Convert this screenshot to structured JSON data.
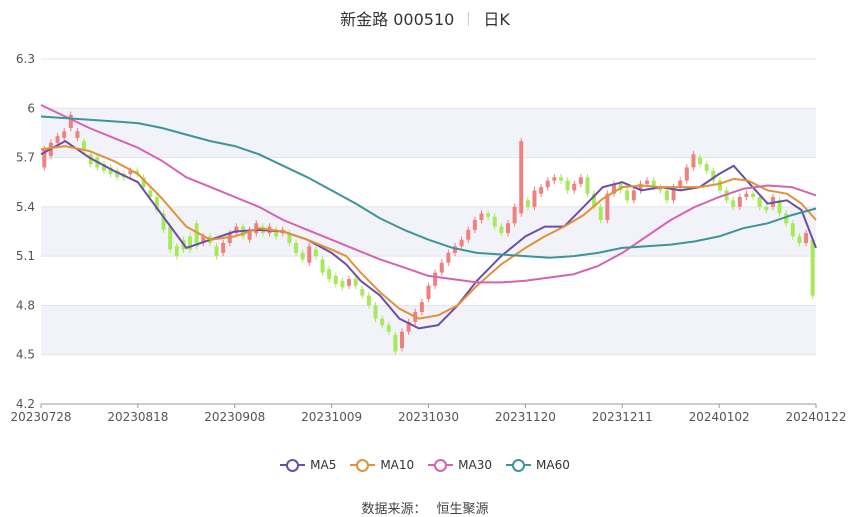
{
  "title": {
    "name": "新金路 000510",
    "period": "日K"
  },
  "legend": [
    {
      "label": "MA5",
      "color": "#6b4ea8"
    },
    {
      "label": "MA10",
      "color": "#e2913a"
    },
    {
      "label": "MA30",
      "color": "#d763b0"
    },
    {
      "label": "MA60",
      "color": "#3d9499"
    }
  ],
  "source": {
    "label": "数据来源：",
    "value": "恒生聚源"
  },
  "colors": {
    "up": "#f07f7f",
    "down": "#a6ea58",
    "band": "#f2f3f8",
    "grid": "#e2e4ea"
  },
  "chart_data": {
    "type": "candlestick",
    "title": "新金路 000510 日K",
    "x_tick_labels": [
      "20230728",
      "20230818",
      "20230908",
      "20231009",
      "20231030",
      "20231120",
      "20231211",
      "20240102",
      "20240122"
    ],
    "y_tick_labels": [
      "6.3",
      "6",
      "5.7",
      "5.4",
      "5.1",
      "4.8",
      "4.5",
      "4.2"
    ],
    "ylim": [
      4.2,
      6.3
    ],
    "y_ticks": [
      6.3,
      6.0,
      5.7,
      5.4,
      5.1,
      4.8,
      4.5,
      4.2
    ],
    "date_range": [
      "20230728",
      "20240122"
    ],
    "series": [
      {
        "name": "MA5",
        "points": [
          [
            0,
            5.72
          ],
          [
            5,
            5.8
          ],
          [
            10,
            5.7
          ],
          [
            15,
            5.62
          ],
          [
            20,
            5.55
          ],
          [
            25,
            5.35
          ],
          [
            30,
            5.15
          ],
          [
            35,
            5.2
          ],
          [
            40,
            5.25
          ],
          [
            45,
            5.26
          ],
          [
            50,
            5.25
          ],
          [
            55,
            5.2
          ],
          [
            60,
            5.12
          ],
          [
            63,
            5.05
          ],
          [
            66,
            4.95
          ],
          [
            70,
            4.86
          ],
          [
            74,
            4.72
          ],
          [
            78,
            4.66
          ],
          [
            82,
            4.68
          ],
          [
            86,
            4.8
          ],
          [
            90,
            4.95
          ],
          [
            95,
            5.1
          ],
          [
            100,
            5.22
          ],
          [
            104,
            5.28
          ],
          [
            108,
            5.28
          ],
          [
            112,
            5.4
          ],
          [
            116,
            5.52
          ],
          [
            120,
            5.55
          ],
          [
            124,
            5.5
          ],
          [
            128,
            5.52
          ],
          [
            132,
            5.5
          ],
          [
            136,
            5.52
          ],
          [
            140,
            5.6
          ],
          [
            143,
            5.65
          ],
          [
            146,
            5.55
          ],
          [
            150,
            5.42
          ],
          [
            154,
            5.44
          ],
          [
            157,
            5.38
          ],
          [
            160,
            5.15
          ]
        ]
      },
      {
        "name": "MA10",
        "points": [
          [
            0,
            5.75
          ],
          [
            5,
            5.77
          ],
          [
            10,
            5.74
          ],
          [
            15,
            5.68
          ],
          [
            20,
            5.6
          ],
          [
            25,
            5.45
          ],
          [
            30,
            5.28
          ],
          [
            35,
            5.2
          ],
          [
            40,
            5.22
          ],
          [
            45,
            5.27
          ],
          [
            50,
            5.25
          ],
          [
            55,
            5.2
          ],
          [
            60,
            5.14
          ],
          [
            63,
            5.1
          ],
          [
            66,
            5.0
          ],
          [
            70,
            4.88
          ],
          [
            74,
            4.78
          ],
          [
            78,
            4.72
          ],
          [
            82,
            4.74
          ],
          [
            86,
            4.8
          ],
          [
            90,
            4.92
          ],
          [
            95,
            5.05
          ],
          [
            100,
            5.15
          ],
          [
            104,
            5.22
          ],
          [
            108,
            5.28
          ],
          [
            112,
            5.35
          ],
          [
            116,
            5.45
          ],
          [
            120,
            5.52
          ],
          [
            124,
            5.53
          ],
          [
            128,
            5.52
          ],
          [
            132,
            5.52
          ],
          [
            136,
            5.52
          ],
          [
            140,
            5.54
          ],
          [
            143,
            5.57
          ],
          [
            146,
            5.56
          ],
          [
            150,
            5.5
          ],
          [
            154,
            5.48
          ],
          [
            157,
            5.42
          ],
          [
            160,
            5.32
          ]
        ]
      },
      {
        "name": "MA30",
        "points": [
          [
            0,
            6.02
          ],
          [
            5,
            5.95
          ],
          [
            10,
            5.88
          ],
          [
            15,
            5.82
          ],
          [
            20,
            5.76
          ],
          [
            25,
            5.68
          ],
          [
            30,
            5.58
          ],
          [
            35,
            5.52
          ],
          [
            40,
            5.46
          ],
          [
            45,
            5.4
          ],
          [
            50,
            5.32
          ],
          [
            55,
            5.26
          ],
          [
            60,
            5.2
          ],
          [
            65,
            5.14
          ],
          [
            70,
            5.08
          ],
          [
            75,
            5.03
          ],
          [
            80,
            4.98
          ],
          [
            85,
            4.96
          ],
          [
            90,
            4.94
          ],
          [
            95,
            4.94
          ],
          [
            100,
            4.95
          ],
          [
            105,
            4.97
          ],
          [
            110,
            4.99
          ],
          [
            115,
            5.04
          ],
          [
            120,
            5.12
          ],
          [
            125,
            5.22
          ],
          [
            130,
            5.32
          ],
          [
            135,
            5.4
          ],
          [
            140,
            5.46
          ],
          [
            145,
            5.51
          ],
          [
            150,
            5.53
          ],
          [
            155,
            5.52
          ],
          [
            160,
            5.47
          ]
        ]
      },
      {
        "name": "MA60",
        "points": [
          [
            0,
            5.95
          ],
          [
            5,
            5.94
          ],
          [
            10,
            5.93
          ],
          [
            15,
            5.92
          ],
          [
            20,
            5.91
          ],
          [
            25,
            5.88
          ],
          [
            30,
            5.84
          ],
          [
            35,
            5.8
          ],
          [
            40,
            5.77
          ],
          [
            45,
            5.72
          ],
          [
            50,
            5.65
          ],
          [
            55,
            5.58
          ],
          [
            60,
            5.5
          ],
          [
            65,
            5.42
          ],
          [
            70,
            5.33
          ],
          [
            75,
            5.26
          ],
          [
            80,
            5.2
          ],
          [
            85,
            5.15
          ],
          [
            90,
            5.12
          ],
          [
            95,
            5.11
          ],
          [
            100,
            5.1
          ],
          [
            105,
            5.09
          ],
          [
            110,
            5.1
          ],
          [
            115,
            5.12
          ],
          [
            120,
            5.15
          ],
          [
            125,
            5.16
          ],
          [
            130,
            5.17
          ],
          [
            135,
            5.19
          ],
          [
            140,
            5.22
          ],
          [
            145,
            5.27
          ],
          [
            150,
            5.3
          ],
          [
            155,
            5.35
          ],
          [
            160,
            5.39
          ]
        ]
      }
    ],
    "candles": [
      [
        5.64,
        5.75
      ],
      [
        5.71,
        5.79
      ],
      [
        5.79,
        5.83
      ],
      [
        5.82,
        5.86
      ],
      [
        5.88,
        5.96
      ],
      [
        5.82,
        5.86
      ],
      [
        5.8,
        5.75
      ],
      [
        5.72,
        5.66
      ],
      [
        5.7,
        5.64
      ],
      [
        5.66,
        5.62
      ],
      [
        5.64,
        5.6
      ],
      [
        5.62,
        5.58
      ],
      [
        5.6,
        5.58
      ],
      [
        5.6,
        5.62
      ],
      [
        5.62,
        5.6
      ],
      [
        5.58,
        5.52
      ],
      [
        5.5,
        5.46
      ],
      [
        5.46,
        5.38
      ],
      [
        5.36,
        5.26
      ],
      [
        5.28,
        5.14
      ],
      [
        5.16,
        5.1
      ],
      [
        5.2,
        5.14
      ],
      [
        5.22,
        5.14
      ],
      [
        5.3,
        5.16
      ],
      [
        5.18,
        5.22
      ],
      [
        5.22,
        5.18
      ],
      [
        5.16,
        5.1
      ],
      [
        5.12,
        5.18
      ],
      [
        5.18,
        5.24
      ],
      [
        5.24,
        5.28
      ],
      [
        5.28,
        5.22
      ],
      [
        5.2,
        5.26
      ],
      [
        5.24,
        5.3
      ],
      [
        5.28,
        5.24
      ],
      [
        5.24,
        5.28
      ],
      [
        5.26,
        5.22
      ],
      [
        5.24,
        5.26
      ],
      [
        5.24,
        5.18
      ],
      [
        5.18,
        5.12
      ],
      [
        5.12,
        5.08
      ],
      [
        5.06,
        5.16
      ],
      [
        5.14,
        5.1
      ],
      [
        5.08,
        5.0
      ],
      [
        5.02,
        4.96
      ],
      [
        4.98,
        4.93
      ],
      [
        4.95,
        4.91
      ],
      [
        4.92,
        4.96
      ],
      [
        4.96,
        4.92
      ],
      [
        4.9,
        4.86
      ],
      [
        4.86,
        4.8
      ],
      [
        4.8,
        4.72
      ],
      [
        4.72,
        4.68
      ],
      [
        4.68,
        4.64
      ],
      [
        4.62,
        4.52
      ],
      [
        4.54,
        4.64
      ],
      [
        4.64,
        4.7
      ],
      [
        4.7,
        4.76
      ],
      [
        4.76,
        4.82
      ],
      [
        4.84,
        4.92
      ],
      [
        4.92,
        5.0
      ],
      [
        5.0,
        5.06
      ],
      [
        5.06,
        5.12
      ],
      [
        5.12,
        5.16
      ],
      [
        5.16,
        5.2
      ],
      [
        5.2,
        5.26
      ],
      [
        5.26,
        5.32
      ],
      [
        5.32,
        5.36
      ],
      [
        5.36,
        5.34
      ],
      [
        5.34,
        5.28
      ],
      [
        5.28,
        5.24
      ],
      [
        5.24,
        5.3
      ],
      [
        5.3,
        5.4
      ],
      [
        5.36,
        5.8
      ],
      [
        5.44,
        5.4
      ],
      [
        5.4,
        5.5
      ],
      [
        5.48,
        5.52
      ],
      [
        5.52,
        5.56
      ],
      [
        5.56,
        5.58
      ],
      [
        5.58,
        5.56
      ],
      [
        5.56,
        5.5
      ],
      [
        5.5,
        5.54
      ],
      [
        5.54,
        5.58
      ],
      [
        5.58,
        5.48
      ],
      [
        5.48,
        5.4
      ],
      [
        5.4,
        5.32
      ],
      [
        5.32,
        5.48
      ],
      [
        5.48,
        5.54
      ],
      [
        5.54,
        5.5
      ],
      [
        5.5,
        5.44
      ],
      [
        5.44,
        5.5
      ],
      [
        5.5,
        5.54
      ],
      [
        5.54,
        5.56
      ],
      [
        5.56,
        5.52
      ],
      [
        5.52,
        5.5
      ],
      [
        5.5,
        5.44
      ],
      [
        5.44,
        5.52
      ],
      [
        5.52,
        5.56
      ],
      [
        5.56,
        5.64
      ],
      [
        5.64,
        5.72
      ],
      [
        5.7,
        5.66
      ],
      [
        5.66,
        5.62
      ],
      [
        5.62,
        5.56
      ],
      [
        5.56,
        5.5
      ],
      [
        5.5,
        5.44
      ],
      [
        5.44,
        5.4
      ],
      [
        5.4,
        5.46
      ],
      [
        5.46,
        5.48
      ],
      [
        5.48,
        5.46
      ],
      [
        5.46,
        5.4
      ],
      [
        5.4,
        5.38
      ],
      [
        5.4,
        5.46
      ],
      [
        5.44,
        5.36
      ],
      [
        5.36,
        5.3
      ],
      [
        5.3,
        5.22
      ],
      [
        5.22,
        5.18
      ],
      [
        5.18,
        5.24
      ],
      [
        5.2,
        4.86
      ]
    ]
  }
}
